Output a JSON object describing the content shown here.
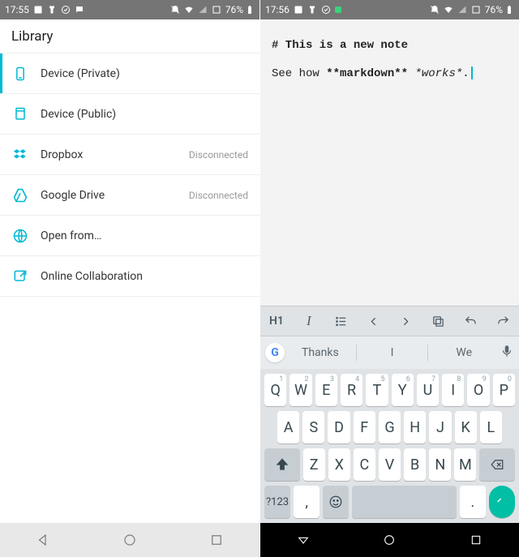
{
  "left": {
    "status": {
      "time": "17:55",
      "battery": "76%"
    },
    "header_title": "Library",
    "items": [
      {
        "label": "Device (Private)",
        "status": "",
        "selected": true
      },
      {
        "label": "Device (Public)",
        "status": ""
      },
      {
        "label": "Dropbox",
        "status": "Disconnected"
      },
      {
        "label": "Google Drive",
        "status": "Disconnected"
      },
      {
        "label": "Open from…",
        "status": ""
      },
      {
        "label": "Online Collaboration",
        "status": ""
      }
    ]
  },
  "right": {
    "status": {
      "time": "17:56",
      "battery": "76%"
    },
    "editor": {
      "line1": "# This is a new note",
      "line2_a": "See how ",
      "line2_b": "**markdown**",
      "line2_c": " ",
      "line2_d": "*works*",
      "line2_e": "."
    },
    "toolbar": {
      "h1": "H1",
      "italic": "I"
    },
    "suggestions": [
      "Thanks",
      "I",
      "We"
    ],
    "keyboard": {
      "row1": [
        {
          "k": "Q",
          "s": "1"
        },
        {
          "k": "W",
          "s": "2"
        },
        {
          "k": "E",
          "s": "3"
        },
        {
          "k": "R",
          "s": "4"
        },
        {
          "k": "T",
          "s": "5"
        },
        {
          "k": "Y",
          "s": "6"
        },
        {
          "k": "U",
          "s": "7"
        },
        {
          "k": "I",
          "s": "8"
        },
        {
          "k": "O",
          "s": "9"
        },
        {
          "k": "P",
          "s": "0"
        }
      ],
      "row2": [
        "A",
        "S",
        "D",
        "F",
        "G",
        "H",
        "J",
        "K",
        "L"
      ],
      "row3": [
        "Z",
        "X",
        "C",
        "V",
        "B",
        "N",
        "M"
      ],
      "sym": "?123",
      "comma": ",",
      "period": "."
    }
  }
}
